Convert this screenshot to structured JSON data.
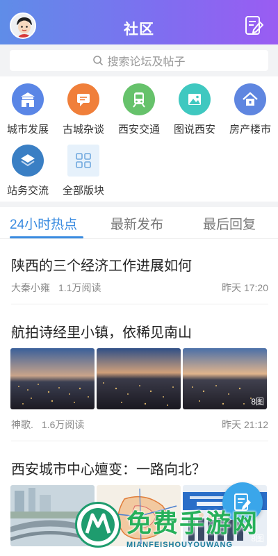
{
  "header": {
    "title": "社区",
    "avatar_icon": "avatar",
    "compose_icon": "compose-icon"
  },
  "search": {
    "placeholder": "搜索论坛及帖子"
  },
  "categories": [
    {
      "label": "城市发展",
      "icon": "building-icon",
      "color": "#5a86e6"
    },
    {
      "label": "古城杂谈",
      "icon": "chat-icon",
      "color": "#f07f3a"
    },
    {
      "label": "西安交通",
      "icon": "train-icon",
      "color": "#66c26b"
    },
    {
      "label": "图说西安",
      "icon": "image-icon",
      "color": "#3fc8c0"
    },
    {
      "label": "房产楼市",
      "icon": "house-icon",
      "color": "#5f86e0"
    },
    {
      "label": "站务交流",
      "icon": "layers-icon",
      "color": "#3a7fc4"
    },
    {
      "label": "全部版块",
      "icon": "grid-icon",
      "color": "#6fa7de"
    }
  ],
  "tabs": [
    {
      "label": "24小时热点",
      "active": true
    },
    {
      "label": "最新发布",
      "active": false
    },
    {
      "label": "最后回复",
      "active": false
    }
  ],
  "posts": [
    {
      "title": "陕西的三个经济工作进展如何",
      "author": "大秦小雍",
      "views": "1.1万阅读",
      "time": "昨天 17:20"
    },
    {
      "title": "航拍诗经里小镇，依稀见南山",
      "author": "神歌.",
      "views": "1.6万阅读",
      "time": "昨天 21:12",
      "image_count": "8图"
    },
    {
      "title": "西安城市中心嬗变：一路向北？",
      "image_count": "8图"
    }
  ],
  "watermark": {
    "text": "免费手游网",
    "sub": "MIANFEISHOUYOUWANG"
  },
  "colors": {
    "accent": "#3a8be0",
    "header_start": "#5f8de8",
    "header_end": "#9a5cf2"
  }
}
